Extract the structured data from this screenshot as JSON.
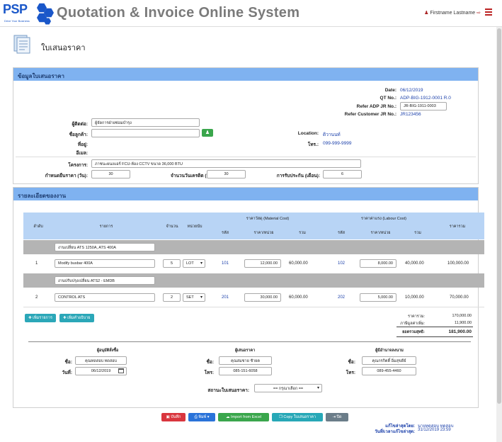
{
  "header": {
    "logo": "PSP",
    "logo_sub": "Drive Your Business",
    "app_title": "Quotation & Invoice Online System",
    "user": "Firstname Lastname"
  },
  "page": {
    "title": "ใบเสนอราคา"
  },
  "info": {
    "panel_title": "ข้อมูลใบเสนอราคา",
    "date_label": "Date:",
    "date_value": "06/12/2019",
    "qt_label": "QT No.:",
    "qt_value": "ADP-BIG-1912-0001 R.0",
    "refer_jr_label": "Refer ADP JR No.:",
    "refer_jr_value": "JR-BIG-1911-0003",
    "refer_cust_label": "Refer Customer JR No.:",
    "refer_cust_value": "JR123456",
    "contact_label": "ผู้ติดต่อ:",
    "contact_value": "ผู้จัดการฝ่ายซ่อมบำรุง",
    "customer_label": "ชื่อลูกค้า:",
    "customer_value": "",
    "address_label": "ที่อยู่:",
    "email_label": "อีเมล:",
    "location_label": "Location:",
    "location_value": "ดิวานนท์",
    "phone_label": "โทร.:",
    "phone_value": "099-999-9999",
    "project_label": "โครงการ:",
    "project_value": "ภาชนะผนงแอร์ FCU-ห้อง CCTV ขนาด 36,000 BTU",
    "price_days_label": "กำหนดยืนราคา (วัน):",
    "price_days_value": "30",
    "credit_days_label": "จำนวนวันเครดิต (วัน):",
    "credit_days_value": "30",
    "warranty_label": "การรับประกัน (เดือน):",
    "warranty_value": "6"
  },
  "detail": {
    "panel_title": "รายละเอียดของงาน",
    "headers": {
      "no": "ลำดับ",
      "item": "รายการ",
      "qty": "จำนวน",
      "unit": "หน่วยนับ",
      "material": "ราคาวัสดุ (Material Cost)",
      "labour": "ราคาค่าแรง (Labour Cost)",
      "code": "รหัส",
      "unit_price": "ราคา/หน่วย",
      "sum": "รวม",
      "total": "ราคารวม"
    },
    "groups": [
      {
        "title": "งานเปลี่ยน ATS 1250A, ATS 400A",
        "row": {
          "no": "1",
          "item": "Modify busbar 400A",
          "qty": "5",
          "unit": "LOT",
          "m_code": "101",
          "m_price": "12,000.00",
          "m_sum": "60,000.00",
          "l_code": "102",
          "l_price": "8,000.00",
          "l_sum": "40,000.00",
          "total": "100,000.00"
        }
      },
      {
        "title": "งานปรับปรุงเปลี่ยน ATS2 - EMDB",
        "row": {
          "no": "2",
          "item": "CONTROL ATS",
          "qty": "2",
          "unit": "SET",
          "m_code": "201",
          "m_price": "30,000.00",
          "m_sum": "60,000.00",
          "l_code": "202",
          "l_price": "5,000.00",
          "l_sum": "10,000.00",
          "total": "70,000.00"
        }
      }
    ],
    "add_item": "เพิ่มรายการ",
    "add_desc": "เพิ่มคำอธิบาย",
    "summary": {
      "subtotal_label": "ราคารวม:",
      "subtotal": "170,000.00",
      "vat_label": "ภาษีมูลค่าเพิ่ม:",
      "vat": "11,900.00",
      "grand_label": "ยอดรวมสุทธิ:",
      "grand": "181,900.00"
    }
  },
  "signers": {
    "approver_title": "ผู้อนุมัติสั่งซื้อ",
    "proposer_title": "ผู้เสนอราคา",
    "owner_title": "ผู้มีอำนาจลงนาม",
    "name_label": "ชื่อ:",
    "date_label": "วันที่:",
    "phone_label": "โทร:",
    "approver_name": "คุณทดสอบ ทดสอบ",
    "approver_date": "06/12/2019",
    "proposer_name": "คุณสมชาย ชัายต",
    "proposer_phone": "085-151-6058",
    "owner_name": "คุณกรกิตติ์ อิ่มสุขดีย์",
    "owner_phone": "089-455-4460"
  },
  "status": {
    "label": "สถานะใบเสนอราคา:",
    "value": "== กรุณาเลือก =="
  },
  "actions": {
    "save": "บันทึก",
    "print": "พิมพ์",
    "import": "Import from Excel",
    "copy": "Copy ใบเสนอราคา",
    "close": "ปิด"
  },
  "footer": {
    "edited_by_label": "แก้ไขล่าสุดโดย:",
    "edited_by": "นายทดสอบ ทดสอบ",
    "edited_at_label": "วันที่/เวลาแก้ไขล่าสุด:",
    "edited_at": "31/12/2019 23:59"
  }
}
